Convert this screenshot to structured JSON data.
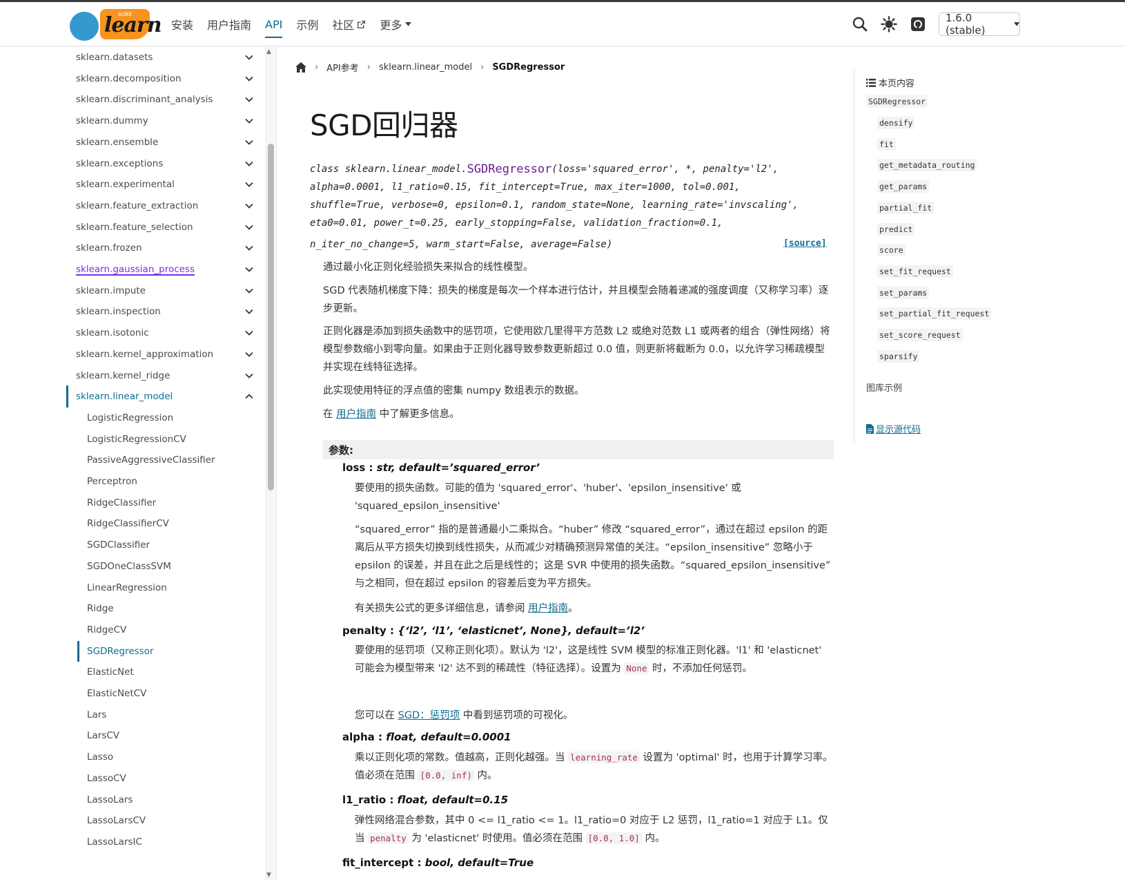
{
  "header": {
    "logo_small": "scikit",
    "logo_text": "learn",
    "nav": [
      {
        "label": "安装"
      },
      {
        "label": "用户指南"
      },
      {
        "label": "API"
      },
      {
        "label": "示例"
      },
      {
        "label": "社区"
      },
      {
        "label": "更多"
      }
    ],
    "version": "1.6.0 (stable)",
    "accent": "#0d6d8f"
  },
  "sidebar": {
    "modules": [
      "sklearn.datasets",
      "sklearn.decomposition",
      "sklearn.discriminant_analysis",
      "sklearn.dummy",
      "sklearn.ensemble",
      "sklearn.exceptions",
      "sklearn.experimental",
      "sklearn.feature_extraction",
      "sklearn.feature_selection",
      "sklearn.frozen",
      "sklearn.gaussian_process",
      "sklearn.impute",
      "sklearn.inspection",
      "sklearn.isotonic",
      "sklearn.kernel_approximation",
      "sklearn.kernel_ridge",
      "sklearn.linear_model"
    ],
    "sub_items": [
      "LogisticRegression",
      "LogisticRegressionCV",
      "PassiveAggressiveClassifier",
      "Perceptron",
      "RidgeClassifier",
      "RidgeClassifierCV",
      "SGDClassifier",
      "SGDOneClassSVM",
      "LinearRegression",
      "Ridge",
      "RidgeCV",
      "SGDRegressor",
      "ElasticNet",
      "ElasticNetCV",
      "Lars",
      "LarsCV",
      "Lasso",
      "LassoCV",
      "LassoLars",
      "LassoLarsCV",
      "LassoLarsIC"
    ]
  },
  "breadcrumb": {
    "items": [
      "API参考",
      "sklearn.linear_model"
    ],
    "current": "SGDRegressor"
  },
  "main": {
    "title": "SGD回归器",
    "signature": {
      "prefix": "class sklearn.linear_model.",
      "class_name": "SGDRegressor",
      "lines": [
        "(loss='squared_error', *, penalty='l2',",
        "alpha=0.0001, l1_ratio=0.15, fit_intercept=True, max_iter=1000, tol=0.001,",
        "shuffle=True, verbose=0, epsilon=0.1, random_state=None, learning_rate='invscaling',",
        "eta0=0.01, power_t=0.25, early_stopping=False, validation_fraction=0.1,",
        "n_iter_no_change=5, warm_start=False, average=False)"
      ],
      "source_label": "[source]"
    },
    "intro": [
      "通过最小化正则化经验损失来拟合的线性模型。",
      "SGD 代表随机梯度下降：损失的梯度是每次一个样本进行估计，并且模型会随着递减的强度调度（又称学习率）逐步更新。",
      "正则化器是添加到损失函数中的惩罚项，它使用欧几里得平方范数 L2 或绝对范数 L1 或两者的组合（弹性网络）将模型参数缩小到零向量。如果由于正则化器导致参数更新超过 0.0 值，则更新将截断为 0.0，以允许学习稀疏模型并实现在线特征选择。",
      "此实现使用特征的浮点值的密集 numpy 数组表示的数据。"
    ],
    "more_info": {
      "pre": "在 ",
      "link": "用户指南",
      "post": " 中了解更多信息。"
    },
    "params_heading": "参数:",
    "params": {
      "loss": {
        "name": "loss",
        "type": "str, default=’squared_error’",
        "desc1": "要使用的损失函数。可能的值为 'squared_error'、'huber'、'epsilon_insensitive' 或 'squared_epsilon_insensitive'",
        "desc2": "“squared_error” 指的是普通最小二乘拟合。“huber” 修改 “squared_error”，通过在超过 epsilon 的距离后从平方损失切换到线性损失，从而减少对精确预测异常值的关注。“epsilon_insensitive” 忽略小于 epsilon 的误差，并且在此之后是线性的；这是 SVR 中使用的损失函数。“squared_epsilon_insensitive” 与之相同，但在超过 epsilon 的容差后变为平方损失。",
        "desc3_pre": "有关损失公式的更多详细信息，请参阅 ",
        "desc3_link": "用户指南",
        "desc3_post": "。"
      },
      "penalty": {
        "name": "penalty",
        "type": "{‘l2’, ‘l1’, ‘elasticnet’, None}, default=’l2’",
        "desc1_pre": "要使用的惩罚项（又称正则化项）。默认为 'l2'，这是线性 SVM 模型的标准正则化器。'l1' 和 'elasticnet' 可能会为模型带来 'l2' 达不到的稀疏性（特征选择）。设置为 ",
        "desc1_code": "None",
        "desc1_post": " 时，不添加任何惩罚。",
        "desc2_pre": "您可以在 ",
        "desc2_link": "SGD：惩罚项",
        "desc2_post": " 中看到惩罚项的可视化。"
      },
      "alpha": {
        "name": "alpha",
        "type": "float, default=0.0001",
        "desc_pre": "乘以正则化项的常数。值越高，正则化越强。当 ",
        "desc_code": "learning_rate",
        "desc_mid": " 设置为 'optimal' 时，也用于计算学习率。值必须在范围 ",
        "desc_code2": "[0.0, inf)",
        "desc_post": " 内。"
      },
      "l1_ratio": {
        "name": "l1_ratio",
        "type": "float, default=0.15",
        "desc_pre": "弹性网络混合参数，其中 0 <= l1_ratio <= 1。l1_ratio=0 对应于 L2 惩罚，l1_ratio=1 对应于 L1。仅当 ",
        "desc_code": "penalty",
        "desc_mid": " 为 'elasticnet' 时使用。值必须在范围 ",
        "desc_code2": "[0.0, 1.0]",
        "desc_post": " 内。"
      },
      "fit_intercept": {
        "name": "fit_intercept",
        "type": "bool, default=True"
      }
    }
  },
  "toc": {
    "title": "本页内容",
    "class_entry": "SGDRegressor",
    "methods": [
      "densify",
      "fit",
      "get_metadata_routing",
      "get_params",
      "partial_fit",
      "predict",
      "score",
      "set_fit_request",
      "set_params",
      "set_partial_fit_request",
      "set_score_request",
      "sparsify"
    ],
    "gallery": "图库示例",
    "show_source": "显示源代码"
  }
}
